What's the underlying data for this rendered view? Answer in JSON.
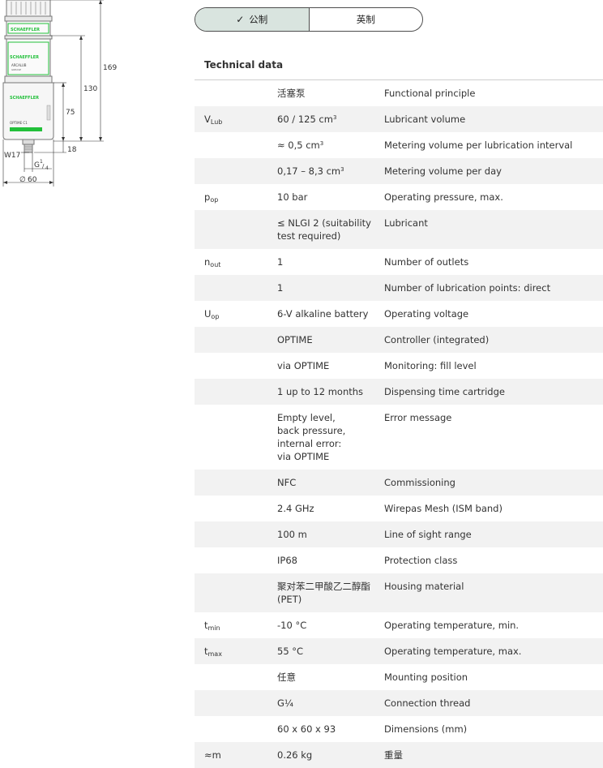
{
  "drawing": {
    "brand": "SCHAEFFLER",
    "cartridge_label": "ARCALUB",
    "cartridge_sub": "GREASE",
    "controller_label": "OPTIME C1",
    "dim_total": "169",
    "dim_cartridge": "130",
    "dim_body": "75",
    "dim_thread_len": "18",
    "dim_wrench": "W17",
    "dim_thread_main": "G",
    "dim_thread_num": "1",
    "dim_thread_den": "4",
    "dim_diameter_symbol": "∅",
    "dim_diameter": "60",
    "accent_green": "#22c03a"
  },
  "toggle": {
    "metric": "公制",
    "imperial": "英制"
  },
  "section_title": "Technical data",
  "rows": [
    {
      "sym": "",
      "sub": "",
      "value": "活塞泵",
      "sup": "",
      "desc": "Functional principle"
    },
    {
      "sym": "V",
      "sub": "Lub",
      "value": "60 / 125 cm",
      "sup": "3",
      "desc": "Lubricant volume"
    },
    {
      "sym": "",
      "sub": "",
      "value": "≈ 0,5 cm",
      "sup": "3",
      "desc": "Metering volume per lubrication interval"
    },
    {
      "sym": "",
      "sub": "",
      "value": "0,17 – 8,3 cm",
      "sup": "3",
      "desc": "Metering volume per day"
    },
    {
      "sym": "p",
      "sub": "op",
      "value": "10 bar",
      "sup": "",
      "desc": "Operating pressure, max."
    },
    {
      "sym": "",
      "sub": "",
      "value": "≤ NLGI 2 (suitability\ntest required)",
      "sup": "",
      "desc": "Lubricant"
    },
    {
      "sym": "n",
      "sub": "out",
      "value": "1",
      "sup": "",
      "desc": "Number of outlets"
    },
    {
      "sym": "",
      "sub": "",
      "value": "1",
      "sup": "",
      "desc": "Number of lubrication points: direct"
    },
    {
      "sym": "U",
      "sub": "op",
      "value": "6-V alkaline battery",
      "sup": "",
      "desc": "Operating voltage"
    },
    {
      "sym": "",
      "sub": "",
      "value": "OPTIME",
      "sup": "",
      "desc": "Controller (integrated)"
    },
    {
      "sym": "",
      "sub": "",
      "value": "via OPTIME",
      "sup": "",
      "desc": "Monitoring: fill level"
    },
    {
      "sym": "",
      "sub": "",
      "value": "1 up to 12 months",
      "sup": "",
      "desc": "Dispensing time cartridge"
    },
    {
      "sym": "",
      "sub": "",
      "value": "Empty level,\nback pressure,\ninternal error:\nvia OPTIME",
      "sup": "",
      "desc": "Error message"
    },
    {
      "sym": "",
      "sub": "",
      "value": "NFC",
      "sup": "",
      "desc": "Commissioning"
    },
    {
      "sym": "",
      "sub": "",
      "value": "2.4 GHz",
      "sup": "",
      "desc": "Wirepas Mesh (ISM band)"
    },
    {
      "sym": "",
      "sub": "",
      "value": "100 m",
      "sup": "",
      "desc": "Line of sight range"
    },
    {
      "sym": "",
      "sub": "",
      "value": "IP68",
      "sup": "",
      "desc": "Protection class"
    },
    {
      "sym": "",
      "sub": "",
      "value": "聚对苯二甲酸乙二醇酯\n(PET)",
      "sup": "",
      "desc": "Housing material"
    },
    {
      "sym": "t",
      "sub": "min",
      "value": "-10 °C",
      "sup": "",
      "desc": "Operating temperature, min."
    },
    {
      "sym": "t",
      "sub": "max",
      "value": "55 °C",
      "sup": "",
      "desc": "Operating temperature, max."
    },
    {
      "sym": "",
      "sub": "",
      "value": "任意",
      "sup": "",
      "desc": "Mounting position"
    },
    {
      "sym": "",
      "sub": "",
      "value": "G¼",
      "sup": "",
      "desc": "Connection thread"
    },
    {
      "sym": "",
      "sub": "",
      "value": "60 x 60 x 93",
      "sup": "",
      "desc": "Dimensions (mm)"
    },
    {
      "sym": "≈m",
      "sub": "",
      "value": "0.26 kg",
      "sup": "",
      "desc": "重量"
    }
  ]
}
